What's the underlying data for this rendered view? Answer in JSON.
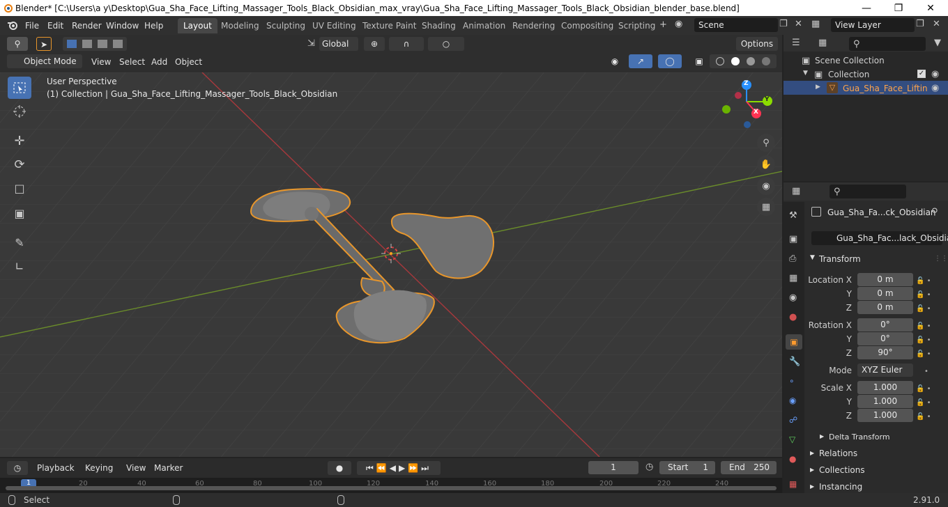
{
  "window": {
    "title": "Blender* [C:\\Users\\a y\\Desktop\\Gua_Sha_Face_Lifting_Massager_Tools_Black_Obsidian_max_vray\\Gua_Sha_Face_Lifting_Massager_Tools_Black_Obsidian_blender_base.blend]"
  },
  "menubar": {
    "file": "File",
    "edit": "Edit",
    "render": "Render",
    "window": "Window",
    "help": "Help"
  },
  "workspaces": [
    "Layout",
    "Modeling",
    "Sculpting",
    "UV Editing",
    "Texture Paint",
    "Shading",
    "Animation",
    "Rendering",
    "Compositing",
    "Scripting"
  ],
  "scene": {
    "name": "Scene",
    "view_layer": "View Layer"
  },
  "viewport_header": {
    "transform_orientation": "Global",
    "options": "Options",
    "mode": "Object Mode",
    "view": "View",
    "select": "Select",
    "add": "Add",
    "object": "Object"
  },
  "viewport": {
    "perspective": "User Perspective",
    "collection_info": "(1) Collection | Gua_Sha_Face_Lifting_Massager_Tools_Black_Obsidian"
  },
  "gizmo": {
    "x": "X",
    "y": "Y",
    "z": "Z"
  },
  "outliner": {
    "scene_collection": "Scene Collection",
    "collection": "Collection",
    "object": "Gua_Sha_Face_Liftin"
  },
  "properties": {
    "object_name": "Gua_Sha_Fa...ck_Obsidian",
    "data_name": "Gua_Sha_Fac...lack_Obsidian",
    "transform": "Transform",
    "location_x_label": "Location X",
    "location_x": "0 m",
    "location_y_label": "Y",
    "location_y": "0 m",
    "location_z_label": "Z",
    "location_z": "0 m",
    "rotation_x_label": "Rotation X",
    "rotation_x": "0°",
    "rotation_y_label": "Y",
    "rotation_y": "0°",
    "rotation_z_label": "Z",
    "rotation_z": "90°",
    "mode_label": "Mode",
    "mode": "XYZ Euler",
    "scale_x_label": "Scale X",
    "scale_x": "1.000",
    "scale_y_label": "Y",
    "scale_y": "1.000",
    "scale_z_label": "Z",
    "scale_z": "1.000",
    "delta_transform": "Delta Transform",
    "relations": "Relations",
    "collections": "Collections",
    "instancing": "Instancing"
  },
  "timeline": {
    "playback": "Playback",
    "keying": "Keying",
    "view": "View",
    "marker": "Marker",
    "current_frame": "1",
    "start_label": "Start",
    "start": "1",
    "end_label": "End",
    "end": "250",
    "ruler": [
      "1",
      "20",
      "40",
      "60",
      "80",
      "100",
      "120",
      "140",
      "160",
      "180",
      "200",
      "220",
      "240"
    ]
  },
  "statusbar": {
    "select": "Select",
    "version": "2.91.0"
  },
  "colors": {
    "selection_outline": "#e8962b",
    "active_blue": "#4772b3",
    "x_axis": "#ff3352",
    "y_axis": "#8bdc00",
    "z_axis": "#2890ff"
  }
}
